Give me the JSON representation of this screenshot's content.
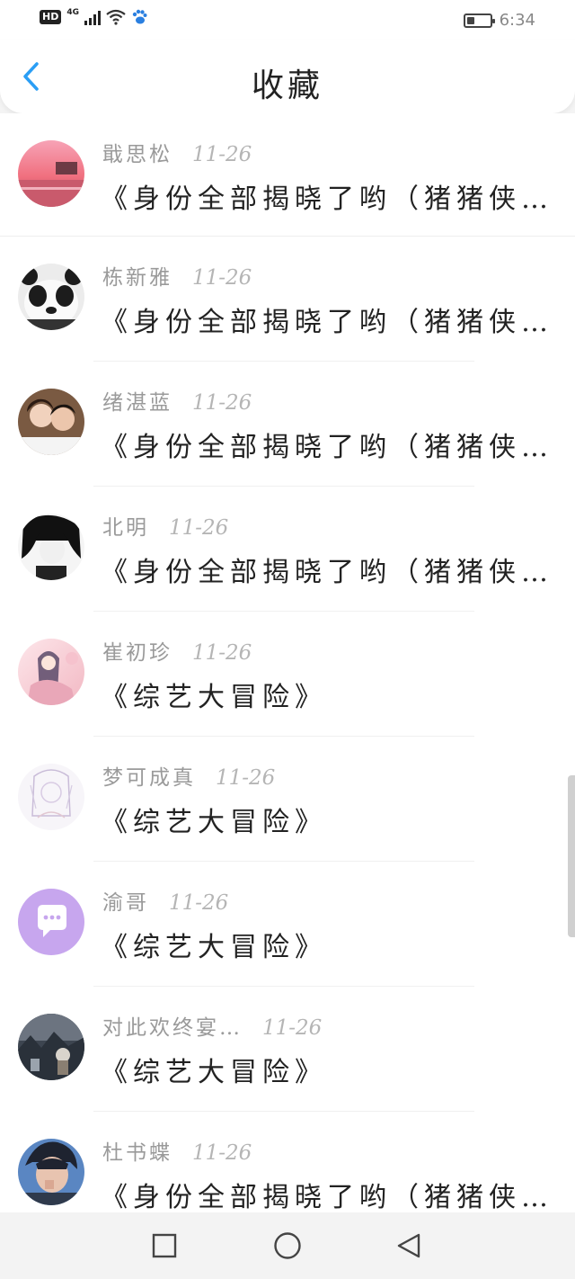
{
  "status_bar": {
    "hd": "HD",
    "network": "4G",
    "time": "6:34",
    "battery_level": 0.35
  },
  "header": {
    "title": "收藏",
    "back_icon": "chevron-left-icon",
    "accent": "#2a9ef5"
  },
  "items": [
    {
      "name": "戢思松",
      "date": "11-26",
      "content": "《身份全部揭晓了哟（猪猪侠…",
      "avatar": "sunset-photo"
    },
    {
      "name": "栋新雅",
      "date": "11-26",
      "content": "《身份全部揭晓了哟（猪猪侠…",
      "avatar": "panda-photo"
    },
    {
      "name": "绪湛蓝",
      "date": "11-26",
      "content": "《身份全部揭晓了哟（猪猪侠…",
      "avatar": "couple-photo"
    },
    {
      "name": "北明",
      "date": "11-26",
      "content": "《身份全部揭晓了哟（猪猪侠…",
      "avatar": "anime-dark-photo"
    },
    {
      "name": "崔初珍",
      "date": "11-26",
      "content": "《综艺大冒险》",
      "avatar": "anime-pink-photo"
    },
    {
      "name": "梦可成真",
      "date": "11-26",
      "content": "《综艺大冒险》",
      "avatar": "anime-sketch-photo"
    },
    {
      "name": "渝哥",
      "date": "11-26",
      "content": "《综艺大冒险》",
      "avatar": "chat-bubble-icon"
    },
    {
      "name": "对此欢终宴…",
      "date": "11-26",
      "content": "《综艺大冒险》",
      "avatar": "scenery-photo"
    },
    {
      "name": "杜书蝶",
      "date": "11-26",
      "content": "《身份全部揭晓了哟（猪猪侠…",
      "avatar": "portrait-photo"
    }
  ],
  "navbar": {
    "recent_icon": "square-icon",
    "home_icon": "circle-icon",
    "back_icon": "triangle-back-icon"
  }
}
